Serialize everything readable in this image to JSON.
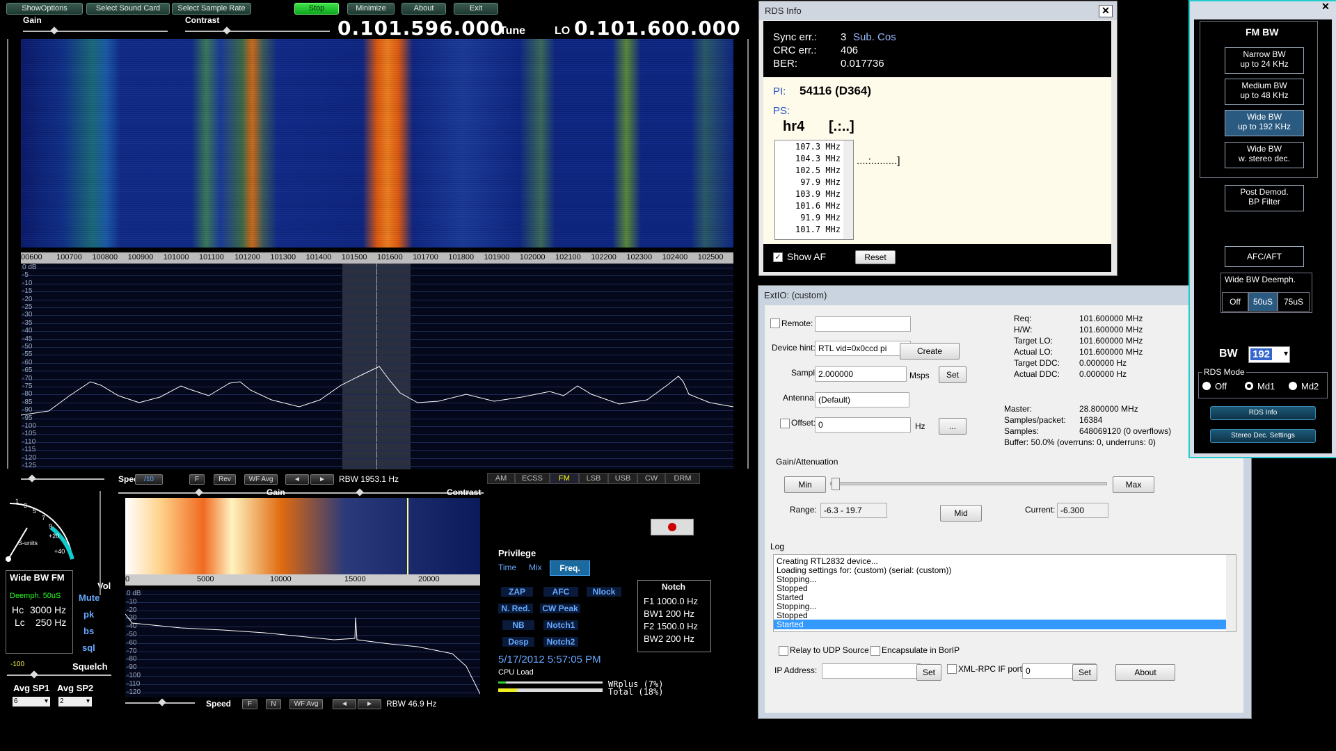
{
  "toolbar": {
    "show_options": "ShowOptions",
    "select_sound_card": "Select Sound Card",
    "select_sample_rate": "Select Sample Rate",
    "stop": "Stop",
    "minimize": "Minimize",
    "about": "About",
    "exit": "Exit"
  },
  "main": {
    "gain_label": "Gain",
    "contrast_label": "Contrast",
    "tune_freq": "0.101.596.000",
    "tune_label": "Tune",
    "lo_label": "LO",
    "lo_freq": "0.101.600.000",
    "freq_axis": [
      "00600",
      "100700",
      "100800",
      "100900",
      "101000",
      "101100",
      "101200",
      "101300",
      "101400",
      "101500",
      "101600",
      "101700",
      "101800",
      "101900",
      "102000",
      "102100",
      "102200",
      "102300",
      "102400",
      "102500"
    ],
    "db_axis": [
      "0 dB",
      "-5",
      "-10",
      "-15",
      "-20",
      "-25",
      "-30",
      "-35",
      "-40",
      "-45",
      "-50",
      "-55",
      "-60",
      "-65",
      "-70",
      "-75",
      "-80",
      "-85",
      "-90",
      "-95",
      "-100",
      "-105",
      "-110",
      "-115",
      "-120",
      "-125"
    ],
    "speed_label": "Speed",
    "div10": "/10",
    "f_btn": "F",
    "rev_btn": "Rev",
    "wfavg_btn": "WF Avg",
    "rbw": "RBW 1953.1 Hz",
    "modes": [
      "AM",
      "ECSS",
      "FM",
      "LSB",
      "USB",
      "CW",
      "DRM"
    ]
  },
  "audio": {
    "gain_label": "Gain",
    "contrast_label": "Contrast",
    "freq_ticks": [
      "0",
      "5000",
      "10000",
      "15000",
      "20000"
    ],
    "db_ticks": [
      "0 dB",
      "-10",
      "-20",
      "-30",
      "-40",
      "-50",
      "-60",
      "-70",
      "-80",
      "-90",
      "-100",
      "-110",
      "-120"
    ],
    "speed_label": "Speed",
    "f_btn": "F",
    "n_btn": "N",
    "wfavg_btn": "WF Avg",
    "rbw": "RBW 46.9 Hz"
  },
  "smeter": {
    "scale": [
      "1",
      "3",
      "5",
      "7",
      "9",
      "+20",
      "+40"
    ],
    "units": "S-units"
  },
  "demod": {
    "title": "Wide BW FM",
    "deemph": "Deemph. 50uS",
    "hc_label": "Hc",
    "hc_value": "3000 Hz",
    "lc_label": "Lc",
    "lc_value": "250 Hz",
    "squelch_value": "-100",
    "squelch_label": "Squelch",
    "vol_label": "Vol",
    "side_btns": [
      "Mute",
      "pk",
      "bs",
      "sql"
    ],
    "avg_sp1_label": "Avg SP1",
    "avg_sp2_label": "Avg SP2",
    "avg_sp1_value": "6",
    "avg_sp2_value": "2"
  },
  "privilege": {
    "title": "Privilege",
    "tabs": [
      "Time",
      "Mix",
      "Freq."
    ],
    "buttons": [
      "ZAP",
      "AFC",
      "Nlock",
      "N. Red.",
      "CW Peak",
      "NB",
      "Notch1",
      "Desp",
      "Notch2"
    ],
    "datetime": "5/17/2012 5:57:05 PM",
    "cpu_label": "CPU Load",
    "wrplus": "WRplus (7%)",
    "total": "Total  (18%)"
  },
  "notch": {
    "title": "Notch",
    "f1": "F1 1000.0 Hz",
    "bw1": "BW1  200 Hz",
    "f2": "F2 1500.0 Hz",
    "bw2": "BW2  200 Hz"
  },
  "rds": {
    "title": "RDS Info",
    "sync_label": "Sync err.:",
    "sync_value": "3",
    "sub_cos": "Sub. Cos",
    "crc_label": "CRC err.:",
    "crc_value": "406",
    "ber_label": "BER:",
    "ber_value": "0.017736",
    "pi_label": "PI:",
    "pi_value": "54116 (D364)",
    "ps_label": "PS:",
    "ps_value": "hr4",
    "ps_extra": "[.:..]",
    "rt_partial": "....:.........]",
    "af_list": [
      "107.3 MHz",
      "104.3 MHz",
      "102.5 MHz",
      "97.9 MHz",
      "103.9 MHz",
      "101.6 MHz",
      "91.9 MHz",
      "101.7 MHz"
    ],
    "show_af": "Show AF",
    "reset": "Reset"
  },
  "extio": {
    "title": "ExtIO: (custom)",
    "remote_label": "Remote:",
    "device_hint_label": "Device hint:",
    "device_hint_value": "RTL vid=0x0ccd pi",
    "create": "Create",
    "sample_label": "Sample",
    "sample_value": "2.000000",
    "msps": "Msps",
    "set": "Set",
    "antenna_label": "Antenna:",
    "antenna_value": "(Default)",
    "offset_label": "Offset:",
    "offset_value": "0",
    "hz": "Hz",
    "dots": "...",
    "info_labels": [
      "Req:",
      "H/W:",
      "Target LO:",
      "Actual LO:",
      "Target DDC:",
      "Actual DDC:"
    ],
    "info_values": [
      "101.600000 MHz",
      "101.600000 MHz",
      "101.600000 MHz",
      "101.600000 MHz",
      "0.000000 Hz",
      "0.000000 Hz"
    ],
    "master_label": "Master:",
    "master_value": "28.800000 MHz",
    "spp_label": "Samples/packet:",
    "spp_value": "16384",
    "samples_label": "Samples:",
    "samples_value": "648069120 (0 overflows)",
    "buffer": "Buffer: 50.0% (overruns: 0, underruns: 0)",
    "gain_title": "Gain/Attenuation",
    "min": "Min",
    "max": "Max",
    "mid": "Mid",
    "range_label": "Range:",
    "range_value": "-6.3 - 19.7",
    "current_label": "Current:",
    "current_value": "-6.300",
    "log_title": "Log",
    "log": [
      "Creating RTL2832 device...",
      "Loading settings for: (custom) (serial: (custom))",
      "Stopping...",
      "Stopped",
      "Started",
      "Stopping...",
      "Stopped",
      "Started"
    ],
    "relay": "Relay to UDP Source",
    "encapsulate": "Encapsulate in BorIP",
    "ip_label": "IP Address:",
    "xmlrpc": "XML-RPC IF port:",
    "xmlrpc_value": "0",
    "about": "About"
  },
  "fmbw": {
    "title": "FM BW",
    "narrow": [
      "Narrow BW",
      "up to 24 KHz"
    ],
    "medium": [
      "Medium BW",
      "up to 48 KHz"
    ],
    "wide": [
      "Wide BW",
      "up to 192 KHz"
    ],
    "stereo": [
      "Wide BW",
      "w. stereo dec."
    ],
    "post": [
      "Post Demod.",
      "BP Filter"
    ],
    "afc": "AFC/AFT",
    "deemph_title": "Wide BW Deemph.",
    "deemph_opts": [
      "Off",
      "50uS",
      "75uS"
    ],
    "bw_label": "BW",
    "bw_value": "192",
    "rds_mode": "RDS Mode",
    "rds_opts": [
      "Off",
      "Md1",
      "Md2"
    ],
    "rds_info_btn": "RDS Info",
    "stereo_settings_btn": "Stereo Dec. Settings"
  }
}
